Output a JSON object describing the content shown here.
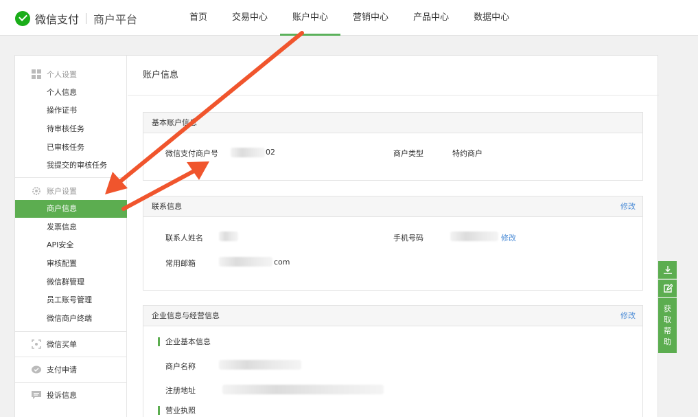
{
  "header": {
    "brand": "微信支付",
    "platform": "商户平台",
    "nav": [
      {
        "label": "首页",
        "active": false
      },
      {
        "label": "交易中心",
        "active": false
      },
      {
        "label": "账户中心",
        "active": true
      },
      {
        "label": "营销中心",
        "active": false
      },
      {
        "label": "产品中心",
        "active": false
      },
      {
        "label": "数据中心",
        "active": false
      }
    ]
  },
  "sidebar": {
    "personal_group": "个人设置",
    "personal_items": [
      "个人信息",
      "操作证书",
      "待审核任务",
      "已审核任务",
      "我提交的审核任务"
    ],
    "account_group": "账户设置",
    "account_items": [
      "商户信息",
      "发票信息",
      "API安全",
      "审核配置",
      "微信群管理",
      "员工账号管理",
      "微信商户终端"
    ],
    "links": [
      "微信买单",
      "支付申请",
      "投诉信息"
    ],
    "active_item": "商户信息"
  },
  "page": {
    "title": "账户信息"
  },
  "basic_info": {
    "heading": "基本账户信息",
    "merchant_id_label": "微信支付商户号",
    "merchant_id_value": "02",
    "merchant_type_label": "商户类型",
    "merchant_type_value": "特约商户"
  },
  "contact_info": {
    "heading": "联系信息",
    "edit": "修改",
    "name_label": "联系人姓名",
    "phone_label": "手机号码",
    "phone_edit": "修改",
    "email_label": "常用邮箱",
    "email_value": "com"
  },
  "enterprise_info": {
    "heading": "企业信息与经营信息",
    "edit": "修改",
    "basic_subheading": "企业基本信息",
    "name_label": "商户名称",
    "address_label": "注册地址",
    "license_subheading": "营业执照"
  },
  "help": {
    "label": [
      "获",
      "取",
      "帮",
      "助"
    ]
  },
  "colors": {
    "accent_green": "#5cad50",
    "link_blue": "#4a8bd6",
    "annotation_arrow": "#f0552d"
  },
  "icons": [
    "wechat-pay-logo-icon",
    "grid-icon",
    "gear-icon",
    "scan-icon",
    "chat-bubble-icon",
    "message-icon",
    "download-icon",
    "edit-icon"
  ]
}
